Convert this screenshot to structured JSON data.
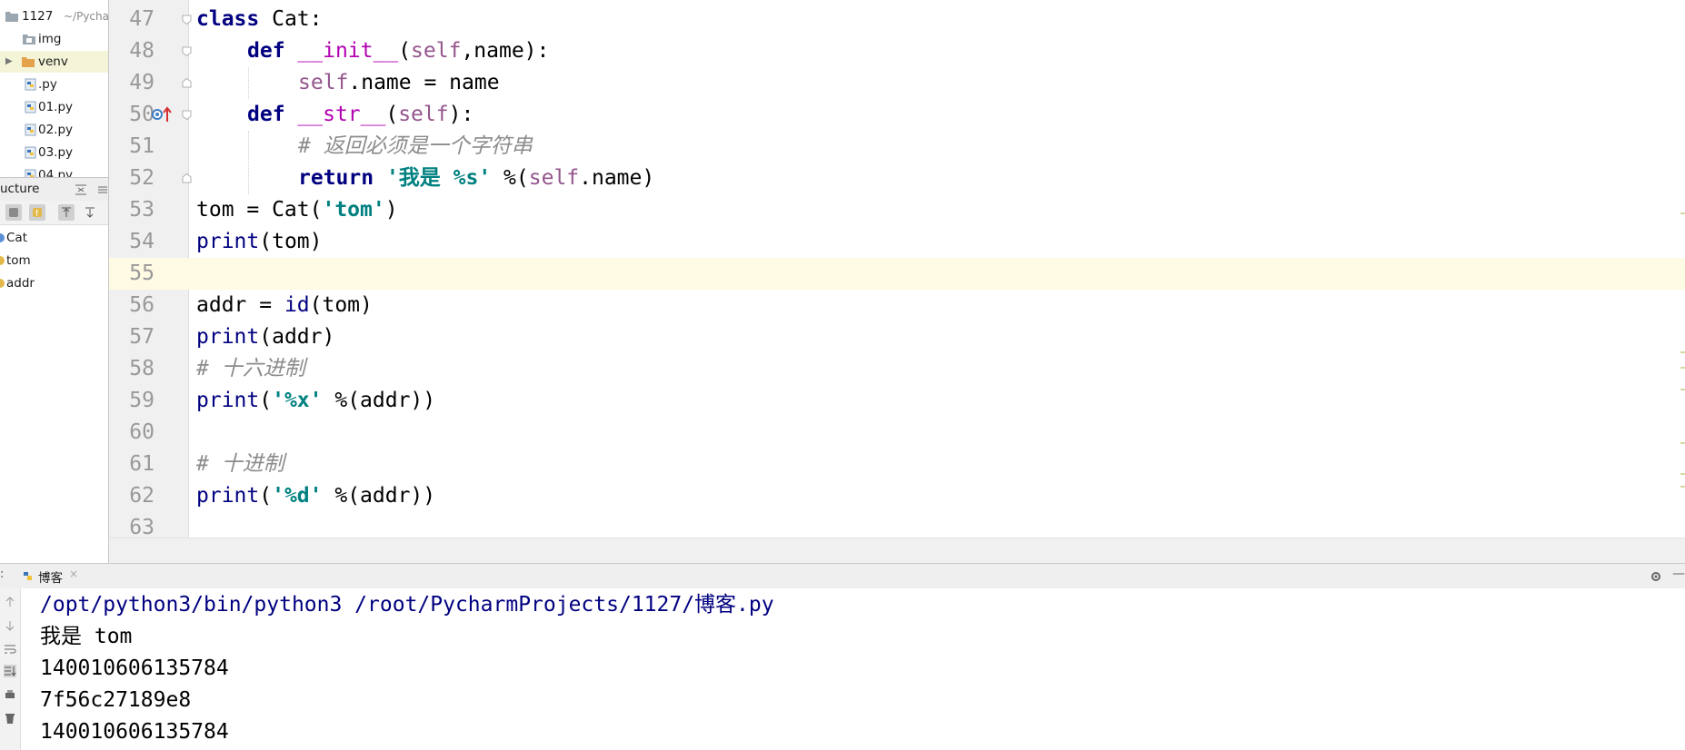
{
  "project": {
    "root_label": "1127",
    "root_path": "~/Pycha",
    "items": [
      {
        "label": "img",
        "type": "folder"
      },
      {
        "label": "venv",
        "type": "folder-excluded"
      },
      {
        "label": ".py",
        "type": "python-file"
      },
      {
        "label": "01.py",
        "type": "python-file"
      },
      {
        "label": "02.py",
        "type": "python-file"
      },
      {
        "label": "03.py",
        "type": "python-file"
      },
      {
        "label": "04.py",
        "type": "python-file"
      }
    ]
  },
  "structure": {
    "title": "ucture",
    "items": [
      {
        "label": "Cat",
        "icon": "class-icon"
      },
      {
        "label": "tom",
        "icon": "variable-icon"
      },
      {
        "label": "addr",
        "icon": "variable-icon"
      }
    ]
  },
  "editor": {
    "line_numbers": [
      "47",
      "48",
      "49",
      "50",
      "51",
      "52",
      "53",
      "54",
      "55",
      "56",
      "57",
      "58",
      "59",
      "60",
      "61",
      "62",
      "63"
    ],
    "highlighted_line": "55",
    "colors": {
      "keyword": "#000080",
      "self": "#94558d",
      "string": "#008080",
      "comment": "#8c8c8c",
      "magic_method": "#b200b2",
      "current_line": "#fffae3"
    }
  },
  "code": {
    "l47": {
      "kw": "class",
      "rest": " Cat:"
    },
    "l48": {
      "kw": "def",
      "name": "__init__",
      "open": "(",
      "self": "self",
      "rest": ",name):"
    },
    "l49": {
      "self": "self",
      "rest": ".name = name"
    },
    "l50": {
      "kw": "def",
      "name": "__str__",
      "open": "(",
      "self": "self",
      "rest": "):"
    },
    "l51": {
      "comment": "# 返回必须是一个字符串"
    },
    "l52": {
      "kw": "return",
      "str": "'我是 %s'",
      "mid": " %(",
      "self": "self",
      "rest": ".name)"
    },
    "l53": {
      "pre": "tom = Cat(",
      "str": "'tom'",
      "rest": ")"
    },
    "l54": {
      "bi": "print",
      "rest": "(tom)"
    },
    "l56": {
      "pre": "addr = ",
      "bi": "id",
      "rest": "(tom)"
    },
    "l57": {
      "bi": "print",
      "rest": "(addr)"
    },
    "l58": {
      "comment": "# 十六进制"
    },
    "l59": {
      "bi": "print",
      "open": "(",
      "str": "'%x'",
      "rest": " %(addr))"
    },
    "l61": {
      "comment": "# 十进制"
    },
    "l62": {
      "bi": "print",
      "open": "(",
      "str": "'%d'",
      "rest": " %(addr))"
    }
  },
  "run": {
    "tab_label": "博客",
    "output": [
      "/opt/python3/bin/python3 /root/PycharmProjects/1127/博客.py",
      "我是 tom",
      "140010606135784",
      "7f56c27189e8",
      "140010606135784"
    ],
    "command_color": "#000080"
  }
}
